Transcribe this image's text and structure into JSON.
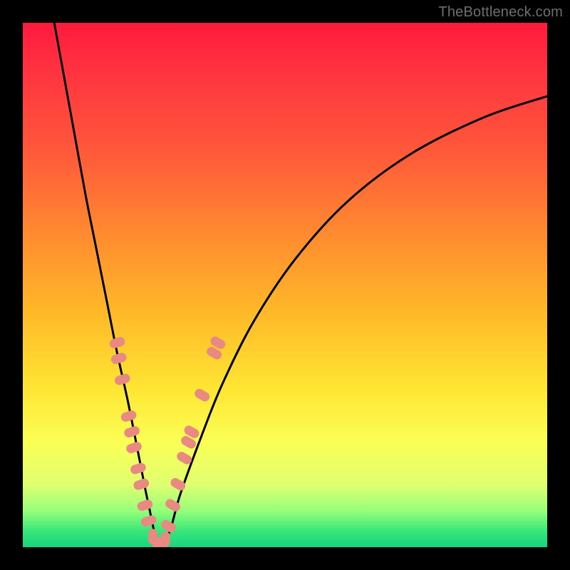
{
  "watermark": "TheBottleneck.com",
  "colors": {
    "frame": "#000000",
    "curve": "#000000",
    "marker_fill": "#e98a82",
    "marker_stroke": "#c97068",
    "gradient_top": "#ff1a3c",
    "gradient_bottom": "#18d47e"
  },
  "chart_data": {
    "type": "line",
    "title": "",
    "xlabel": "",
    "ylabel": "",
    "xlim": [
      0,
      100
    ],
    "ylim": [
      0,
      100
    ],
    "grid": false,
    "legend": false,
    "note": "V-shaped bottleneck curve. x is an abstract configuration parameter (0–100), y is bottleneck percentage (0 = balanced, 100 = fully bottlenecked). The curve minimum (~0%) is near x ≈ 25. Values are estimated from the plot geometry; no axes are labeled in the image.",
    "series": [
      {
        "name": "curve",
        "x": [
          6,
          8,
          10,
          12,
          14,
          16,
          18,
          20,
          22,
          24,
          26,
          28,
          30,
          34,
          38,
          44,
          52,
          62,
          74,
          88,
          100
        ],
        "y": [
          100,
          89,
          78,
          67,
          57,
          47,
          37,
          28,
          18,
          8,
          0,
          3,
          10,
          21,
          31,
          43,
          55,
          66,
          75,
          82,
          86
        ]
      }
    ],
    "markers": {
      "name": "highlighted-points",
      "note": "Salmon elongated markers clustered along both arms of the V near the bottom; coordinates approximate.",
      "points": [
        {
          "x": 18.0,
          "y": 39
        },
        {
          "x": 18.3,
          "y": 36
        },
        {
          "x": 19.0,
          "y": 32
        },
        {
          "x": 20.2,
          "y": 25
        },
        {
          "x": 20.8,
          "y": 22
        },
        {
          "x": 21.2,
          "y": 19
        },
        {
          "x": 22.0,
          "y": 15
        },
        {
          "x": 22.6,
          "y": 12
        },
        {
          "x": 23.3,
          "y": 8
        },
        {
          "x": 24.0,
          "y": 5
        },
        {
          "x": 24.8,
          "y": 2
        },
        {
          "x": 25.6,
          "y": 0.5
        },
        {
          "x": 26.5,
          "y": 0.5
        },
        {
          "x": 27.2,
          "y": 1.5
        },
        {
          "x": 27.8,
          "y": 4
        },
        {
          "x": 28.6,
          "y": 8
        },
        {
          "x": 29.6,
          "y": 12
        },
        {
          "x": 30.8,
          "y": 17
        },
        {
          "x": 31.6,
          "y": 20
        },
        {
          "x": 32.2,
          "y": 22
        },
        {
          "x": 34.2,
          "y": 29
        },
        {
          "x": 36.5,
          "y": 37
        },
        {
          "x": 37.2,
          "y": 39
        }
      ]
    }
  }
}
